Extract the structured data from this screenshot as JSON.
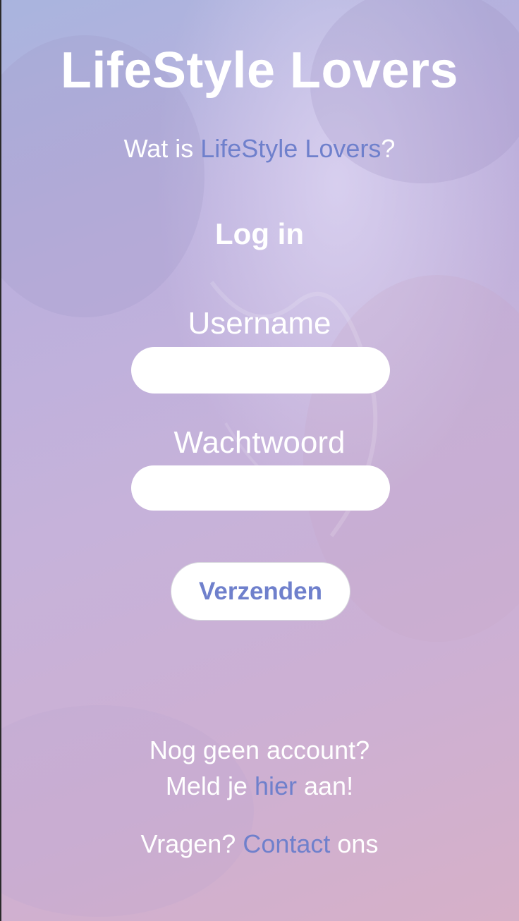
{
  "app": {
    "title": "LifeStyle Lovers"
  },
  "tagline": {
    "prefix": "Wat is ",
    "link": "LifeStyle Lovers",
    "suffix": "?"
  },
  "login": {
    "heading": "Log in",
    "username_label": "Username",
    "username_value": "",
    "password_label": "Wachtwoord",
    "password_value": "",
    "submit_label": "Verzenden"
  },
  "signup": {
    "question": "Nog geen account?",
    "prefix": "Meld je ",
    "link": "hier",
    "suffix": " aan!"
  },
  "contact": {
    "prefix": "Vragen? ",
    "link": "Contact",
    "suffix": " ons"
  },
  "colors": {
    "accent": "#6f80cc",
    "background_start": "#a9b4de",
    "background_end": "#d6b0c8",
    "text": "#ffffff"
  }
}
